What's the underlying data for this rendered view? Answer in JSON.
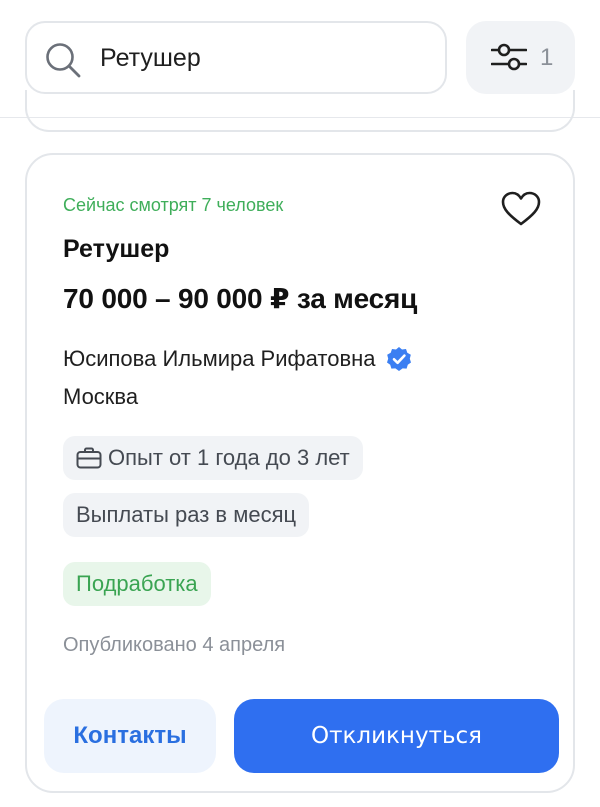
{
  "search": {
    "value": "Ретушер",
    "icon": "search-icon"
  },
  "filter": {
    "icon": "sliders-icon",
    "count": "1"
  },
  "vacancy": {
    "viewers": "Сейчас смотрят 7 человек",
    "title": "Ретушер",
    "salary": "70 000 – 90 000 ₽ за месяц",
    "employer": "Юсипова Ильмира Рифатовна",
    "verified_icon": "verified-badge-icon",
    "city": "Москва",
    "tags": {
      "experience": "Опыт от 1 года до 3 лет",
      "payments": "Выплаты раз в месяц",
      "type": "Подработка"
    },
    "published": "Опубликовано 4 апреля",
    "favorite_icon": "heart-icon"
  },
  "actions": {
    "contacts": "Контакты",
    "apply": "Откликнуться"
  },
  "colors": {
    "accent": "#2f6ff0",
    "green": "#3fae5a",
    "chip_bg": "#f1f3f6",
    "green_chip_bg": "#e8f6ea"
  }
}
